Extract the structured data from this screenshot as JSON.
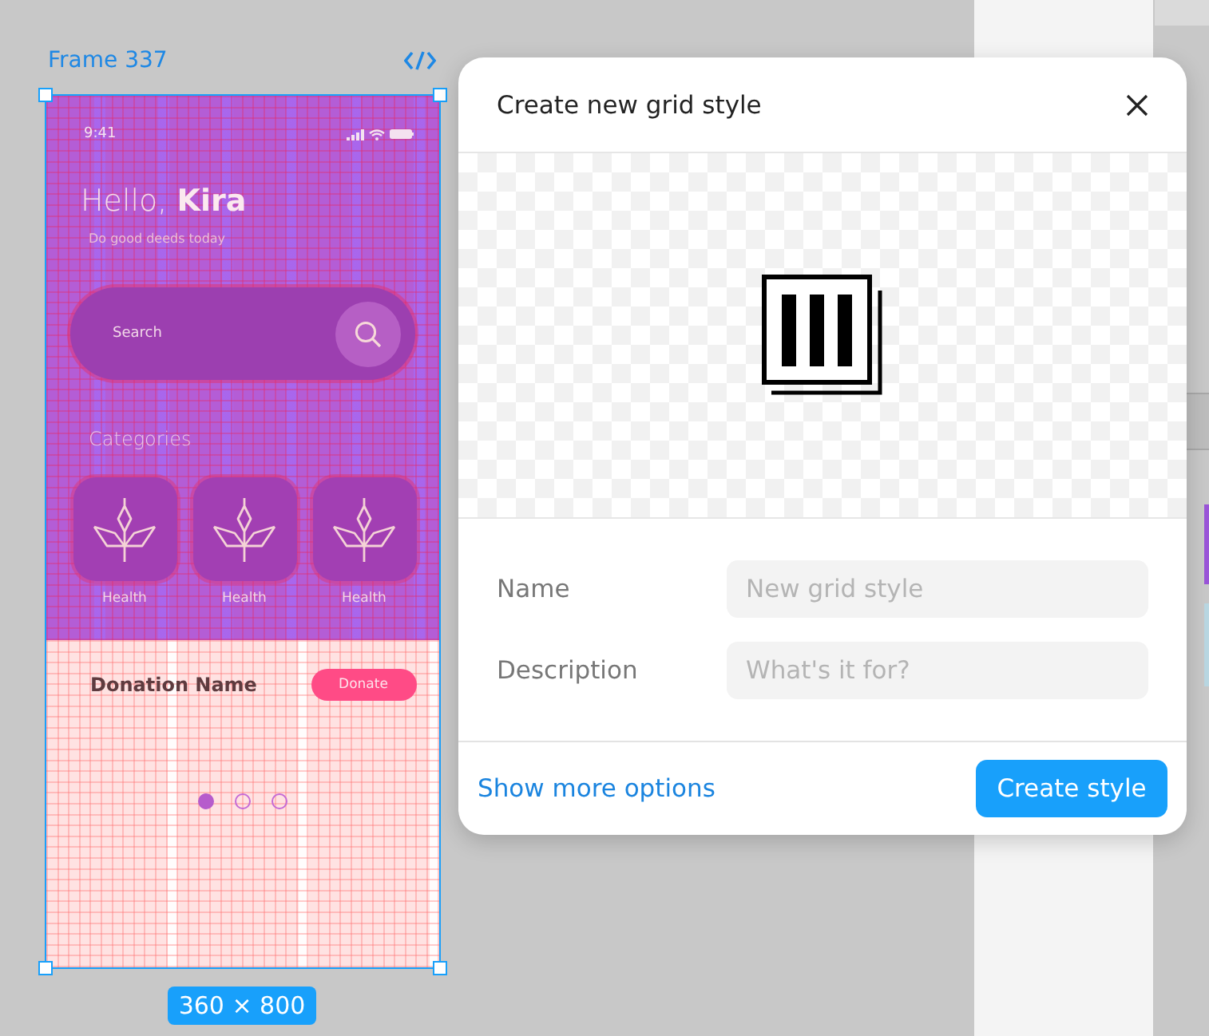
{
  "canvas": {
    "frame_label": "Frame 337",
    "size_badge": "360 × 800"
  },
  "phone": {
    "time": "9:41",
    "greeting": "Hello, **Kira**",
    "subtitle": "Do good deeds today",
    "search": {
      "placeholder": "Search"
    },
    "categories_title": "Categories",
    "categories": [
      {
        "label": "Health"
      },
      {
        "label": "Health"
      },
      {
        "label": "Health"
      }
    ],
    "donation": {
      "title": "Donation Name",
      "button": "Donate"
    },
    "pager": [
      {
        "selected": true
      },
      {
        "selected": false
      },
      {
        "selected": false
      }
    ]
  },
  "dialog": {
    "title": "Create new grid style",
    "fields": [
      {
        "label": "Name",
        "placeholder": "New grid style"
      },
      {
        "label": "Description",
        "placeholder": "What's it for?"
      }
    ],
    "link": "Show more options",
    "primary_button": "Create style"
  }
}
